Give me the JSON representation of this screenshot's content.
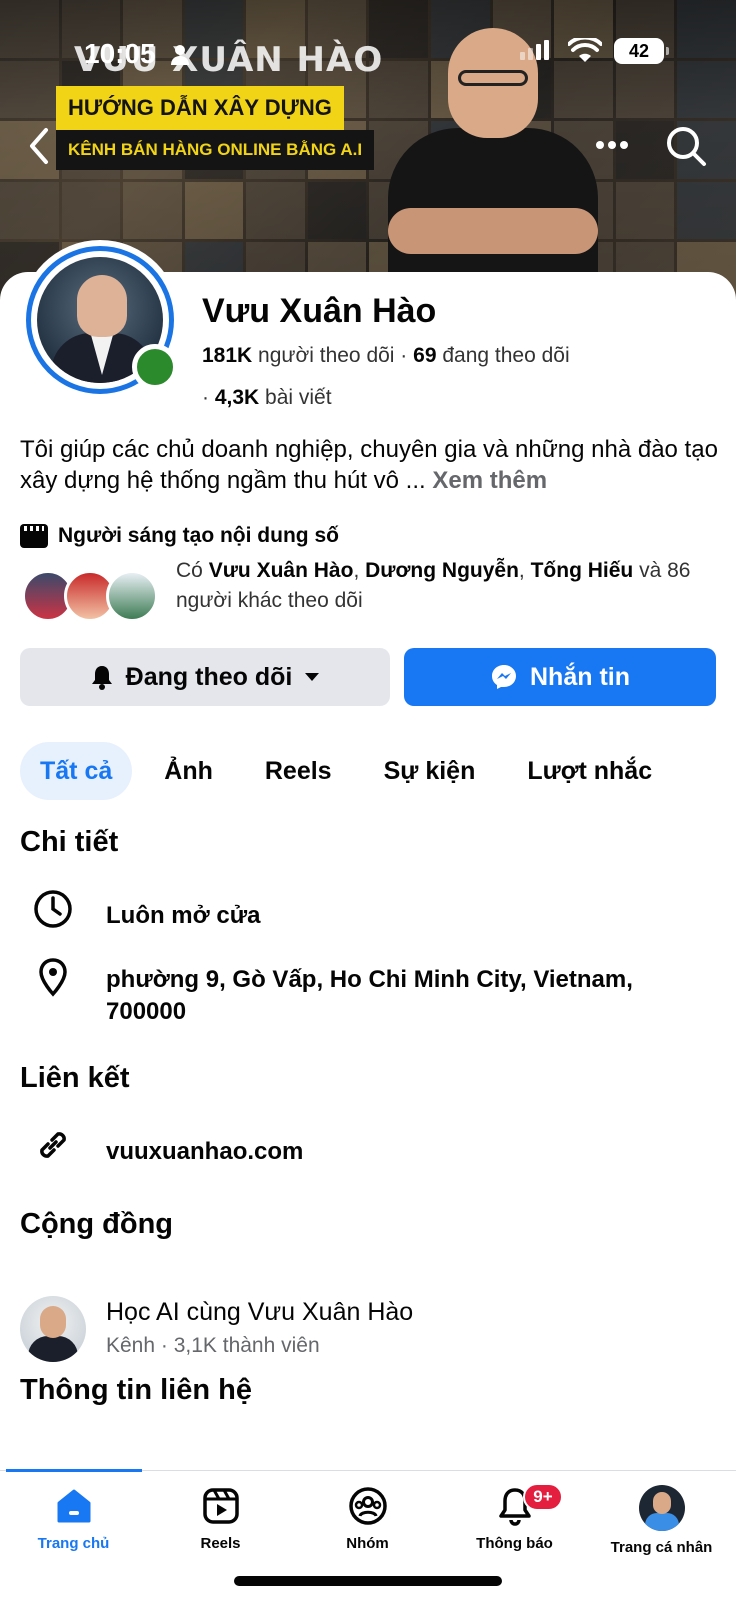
{
  "status_bar": {
    "time": "10:05",
    "battery": "42"
  },
  "cover": {
    "name_text": "VƯU XUÂN HÀO",
    "banner_line1": "HƯỚNG DẪN XÂY DỰNG",
    "banner_line2": "KÊNH BÁN HÀNG ONLINE BẰNG A.I"
  },
  "profile": {
    "name": "Vưu Xuân Hào",
    "followers_count": "181K",
    "followers_label": "người theo dõi",
    "following_count": "69",
    "following_label": "đang theo dõi",
    "posts_count": "4,3K",
    "posts_label": "bài viết",
    "bio": "Tôi giúp các chủ doanh nghiệp, chuyên gia và những nhà đào tạo xây dựng hệ thống ngầm thu hút vô ...",
    "see_more": "Xem thêm",
    "creator_label": "Người sáng tạo nội dung số",
    "mutual_prefix": "Có",
    "mutual_name1": "Vưu Xuân Hào",
    "mutual_name2": "Dương Nguyễn",
    "mutual_name3": "Tống Hiếu",
    "mutual_suffix": "và 86 người khác theo dõi"
  },
  "actions": {
    "following": "Đang theo dõi",
    "message": "Nhắn tin"
  },
  "tabs": [
    "Tất cả",
    "Ảnh",
    "Reels",
    "Sự kiện",
    "Lượt nhắc"
  ],
  "details": {
    "title": "Chi tiết",
    "hours": "Luôn mở cửa",
    "address": "phường 9, Gò Vấp, Ho Chi Minh City, Vietnam, 700000"
  },
  "links": {
    "title": "Liên kết",
    "website": "vuuxuanhao.com"
  },
  "community": {
    "title": "Cộng đồng",
    "name": "Học AI cùng Vưu Xuân Hào",
    "meta": "Kênh · 3,1K thành viên"
  },
  "contact": {
    "title": "Thông tin liên hệ"
  },
  "bottom_nav": {
    "home": "Trang chủ",
    "reels": "Reels",
    "groups": "Nhóm",
    "notifications": "Thông báo",
    "notifications_badge": "9+",
    "profile": "Trang cá nhân"
  },
  "colors": {
    "accent": "#1877f2",
    "online": "#2b8a2b",
    "badge": "#e41e3f"
  }
}
